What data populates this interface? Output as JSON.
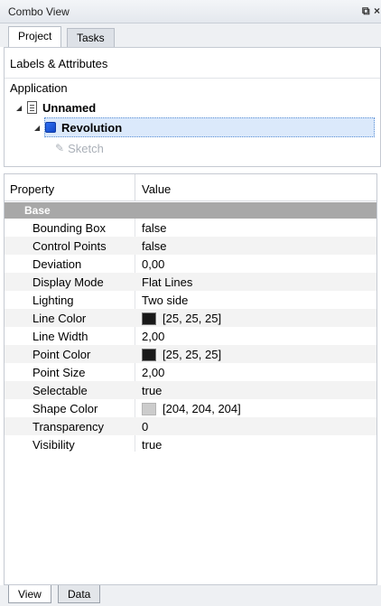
{
  "window": {
    "title": "Combo View"
  },
  "tabs": [
    {
      "label": "Project",
      "active": true
    },
    {
      "label": "Tasks",
      "active": false
    }
  ],
  "tree": {
    "section_label": "Labels & Attributes",
    "application_label": "Application",
    "items": [
      {
        "label": "Unnamed",
        "icon": "document-icon",
        "expanded": true
      },
      {
        "label": "Revolution",
        "icon": "revolution-cube-icon",
        "expanded": true,
        "selected": true
      },
      {
        "label": "Sketch",
        "icon": "sketch-icon",
        "hidden": true
      }
    ]
  },
  "properties": {
    "headers": {
      "property": "Property",
      "value": "Value"
    },
    "group": "Base",
    "rows": [
      {
        "name": "Bounding Box",
        "value": "false"
      },
      {
        "name": "Control Points",
        "value": "false"
      },
      {
        "name": "Deviation",
        "value": "0,00"
      },
      {
        "name": "Display Mode",
        "value": "Flat Lines"
      },
      {
        "name": "Lighting",
        "value": "Two side"
      },
      {
        "name": "Line Color",
        "value": "[25, 25, 25]",
        "color": "#191919"
      },
      {
        "name": "Line Width",
        "value": "2,00"
      },
      {
        "name": "Point Color",
        "value": "[25, 25, 25]",
        "color": "#191919"
      },
      {
        "name": "Point Size",
        "value": "2,00"
      },
      {
        "name": "Selectable",
        "value": "true"
      },
      {
        "name": "Shape Color",
        "value": "[204, 204, 204]",
        "color": "#cccccc"
      },
      {
        "name": "Transparency",
        "value": "0"
      },
      {
        "name": "Visibility",
        "value": "true"
      }
    ]
  },
  "bottom_tabs": [
    {
      "label": "View",
      "active": true
    },
    {
      "label": "Data",
      "active": false
    }
  ]
}
